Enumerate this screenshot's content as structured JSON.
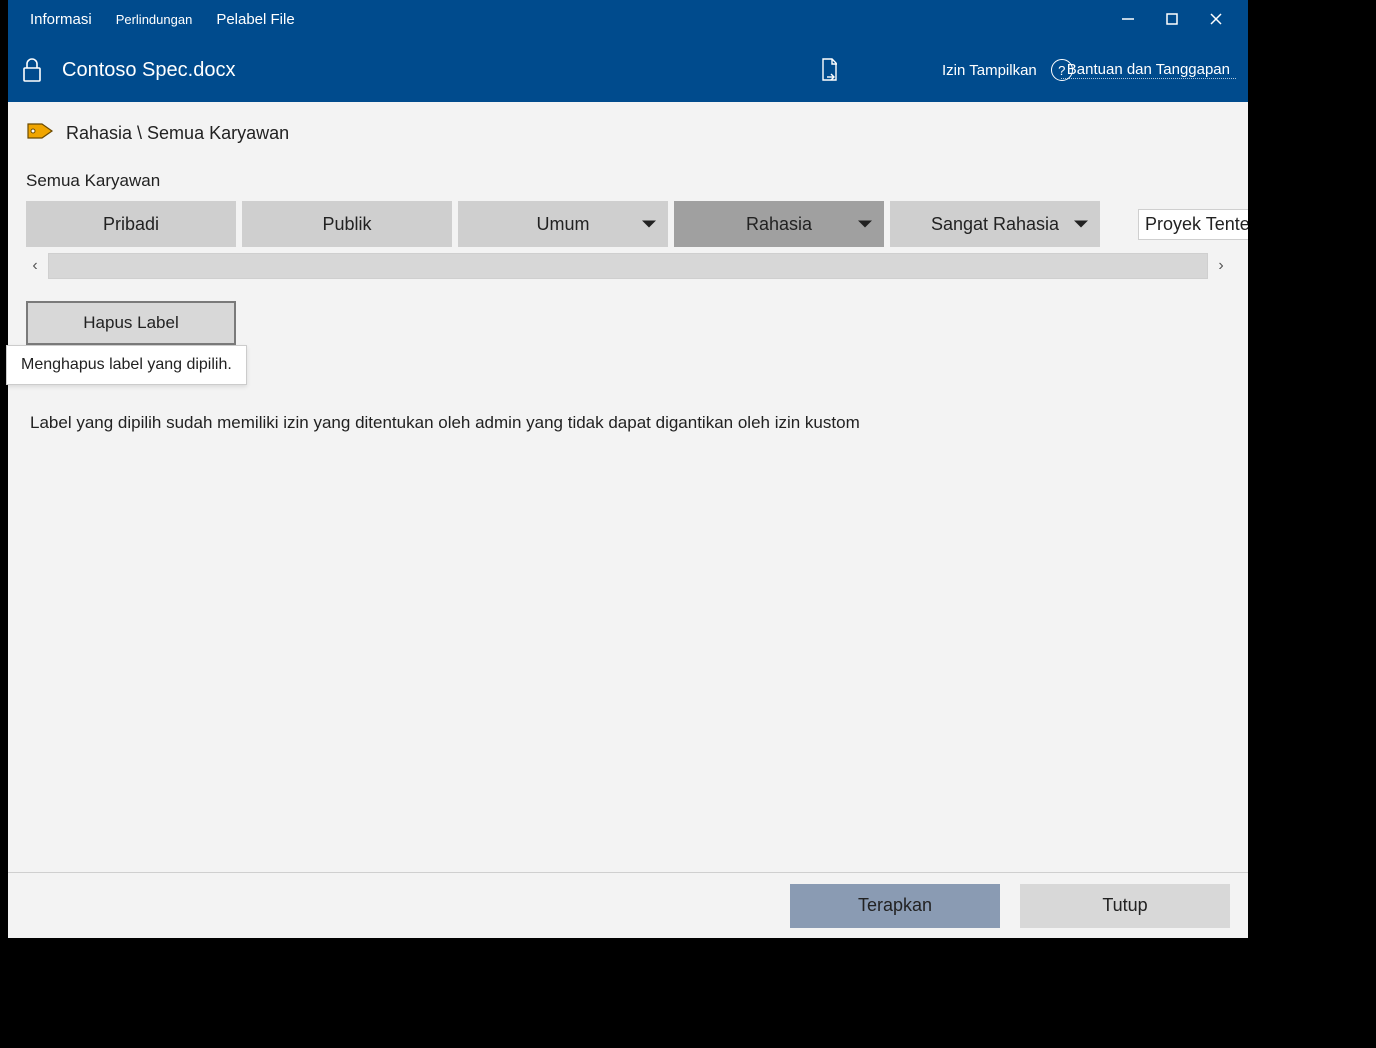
{
  "menu": {
    "info": "Informasi",
    "protection": "Perlindungan",
    "labeler": "Pelabel File"
  },
  "titlebar": {
    "filename": "Contoso Spec.docx",
    "view_perm": "Izin Tampilkan",
    "help": "Bantuan dan Tanggapan"
  },
  "crumb": "Rahasia \\ Semua Karyawan",
  "sub": "Semua Karyawan",
  "labels": {
    "items": [
      {
        "label": "Pribadi",
        "dropdown": false,
        "selected": false
      },
      {
        "label": "Publik",
        "dropdown": false,
        "selected": false
      },
      {
        "label": "Umum",
        "dropdown": true,
        "selected": false
      },
      {
        "label": "Rahasia",
        "dropdown": true,
        "selected": true
      },
      {
        "label": "Sangat Rahasia",
        "dropdown": true,
        "selected": false
      },
      {
        "label": "Proyek Tented",
        "dropdown": false,
        "selected": false,
        "overflow": true
      }
    ]
  },
  "delete": {
    "button": "Hapus Label",
    "tooltip": "Menghapus label yang dipilih."
  },
  "info_line": "Label yang dipilih sudah memiliki izin yang ditentukan oleh admin yang tidak dapat digantikan oleh izin kustom",
  "footer": {
    "apply": "Terapkan",
    "close": "Tutup"
  }
}
